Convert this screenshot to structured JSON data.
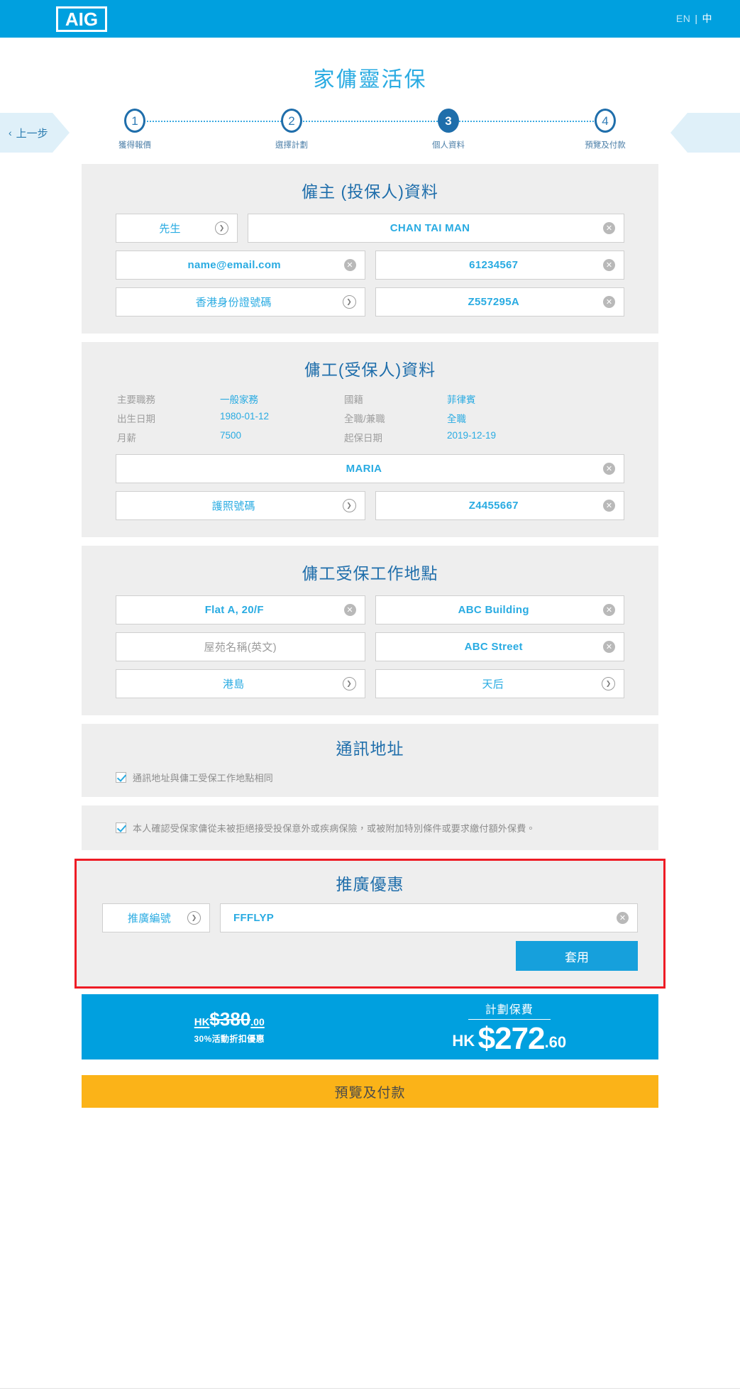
{
  "header": {
    "logo_text": "AIG",
    "lang_en": "EN",
    "lang_sep": "|",
    "lang_zh": "中"
  },
  "page_title": "家傭靈活保",
  "nav": {
    "back_label": "上一步",
    "back_chevron": "‹"
  },
  "stepper": {
    "steps": [
      {
        "number": "1",
        "label": "獲得報價",
        "active": false
      },
      {
        "number": "2",
        "label": "選擇計劃",
        "active": false
      },
      {
        "number": "3",
        "label": "個人資料",
        "active": true
      },
      {
        "number": "4",
        "label": "預覽及付款",
        "active": false
      }
    ]
  },
  "employer": {
    "title": "僱主 (投保人)資料",
    "salutation": "先生",
    "name": "CHAN TAI MAN",
    "email": "name@email.com",
    "phone": "61234567",
    "id_type": "香港身份證號碼",
    "id_number": "Z557295A"
  },
  "employee": {
    "title": "傭工(受保人)資料",
    "info": [
      {
        "key": "主要職務",
        "value": "一般家務"
      },
      {
        "key": "國籍",
        "value": "菲律賓"
      },
      {
        "key": "出生日期",
        "value": "1980-01-12"
      },
      {
        "key": "全職/兼職",
        "value": "全職"
      },
      {
        "key": "月薪",
        "value": "7500"
      },
      {
        "key": "起保日期",
        "value": "2019-12-19"
      }
    ],
    "name": "MARIA",
    "doc_type": "護照號碼",
    "doc_number": "Z4455667"
  },
  "workplace": {
    "title": "傭工受保工作地點",
    "flat": "Flat A, 20/F",
    "building": "ABC Building",
    "estate_placeholder": "屋苑名稱(英文)",
    "street": "ABC Street",
    "district_region": "港島",
    "district": "天后"
  },
  "mailing": {
    "title": "通訊地址",
    "same_as_work": "通訊地址與傭工受保工作地點相同"
  },
  "consent": {
    "text": "本人確認受保家傭從未被拒絕接受投保意外或疾病保險，或被附加特別條件或要求繳付額外保費。"
  },
  "promo": {
    "title": "推廣優惠",
    "code_type": "推廣編號",
    "code_value": "FFFLYP",
    "apply_label": "套用"
  },
  "premium": {
    "old_hk": "HK",
    "old_amount": "$380",
    "old_cents": ".00",
    "discount_text": "30%活動折扣優惠",
    "caption": "計劃保費",
    "hk": "HK",
    "amount": "$272",
    "cents": ".60"
  },
  "cta": {
    "label": "預覽及付款"
  },
  "icons": {
    "clear": "✕",
    "chevron_down": "❯"
  },
  "colors": {
    "brand_blue": "#00a0df",
    "accent_blue": "#29abe2",
    "dark_blue": "#1f6eab",
    "promo_border": "#ee1c25",
    "cta_yellow": "#fbb318",
    "card_bg": "#eeeeee"
  }
}
